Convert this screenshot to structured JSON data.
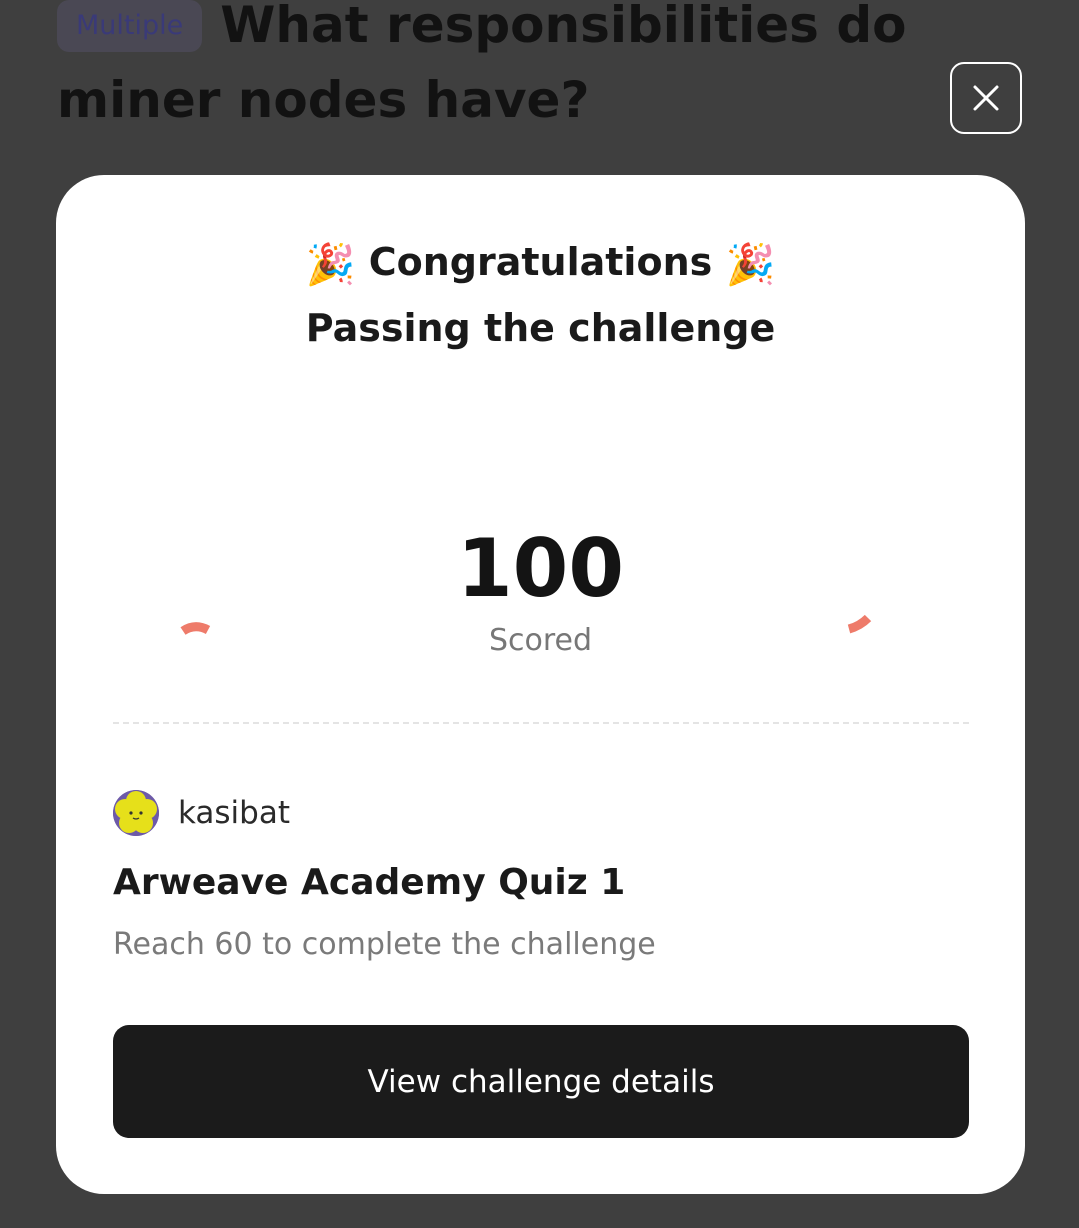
{
  "background": {
    "question_type_badge": "Multiple",
    "question_text": "What responsibilities do miner nodes have?"
  },
  "modal": {
    "title": "Congratulations",
    "title_emoji": "🎉",
    "subtitle": "Passing the challenge",
    "score": {
      "value": "100",
      "label": "Scored",
      "fraction": 1.0
    },
    "user": {
      "name": "kasibat"
    },
    "quiz_title": "Arweave Academy Quiz 1",
    "requirement": "Reach 60 to complete the challenge",
    "cta_label": "View challenge details"
  },
  "colors": {
    "gauge": "#00d882",
    "confetti_red": "#ee7b6a",
    "confetti_orange": "#f4b24e",
    "confetti_green": "#7fb07f",
    "confetti_purple": "#7a3d63",
    "overlay": "#3f3f3f",
    "button": "#1b1b1b"
  }
}
